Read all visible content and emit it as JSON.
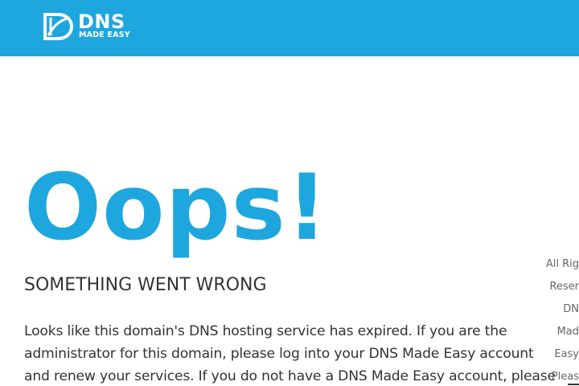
{
  "header": {
    "logo": {
      "icon": "dns-logo-mark",
      "brand": "DNS",
      "tagline": "MADE EASY"
    }
  },
  "main": {
    "headline": "Oops!",
    "subtitle": "SOMETHING WENT WRONG",
    "message": "Looks like this domain's DNS hosting service has expired. If you are the administrator for this domain, please log into your DNS Made Easy account and renew your services. If you do not have a DNS Made Easy account, please"
  },
  "footer_side": {
    "lines": [
      "All Rig",
      "Reser",
      "DN",
      "Mad",
      "Easy",
      "Pleas"
    ]
  },
  "colors": {
    "accent": "#1ea7de",
    "text": "#333333",
    "muted": "#666666"
  }
}
